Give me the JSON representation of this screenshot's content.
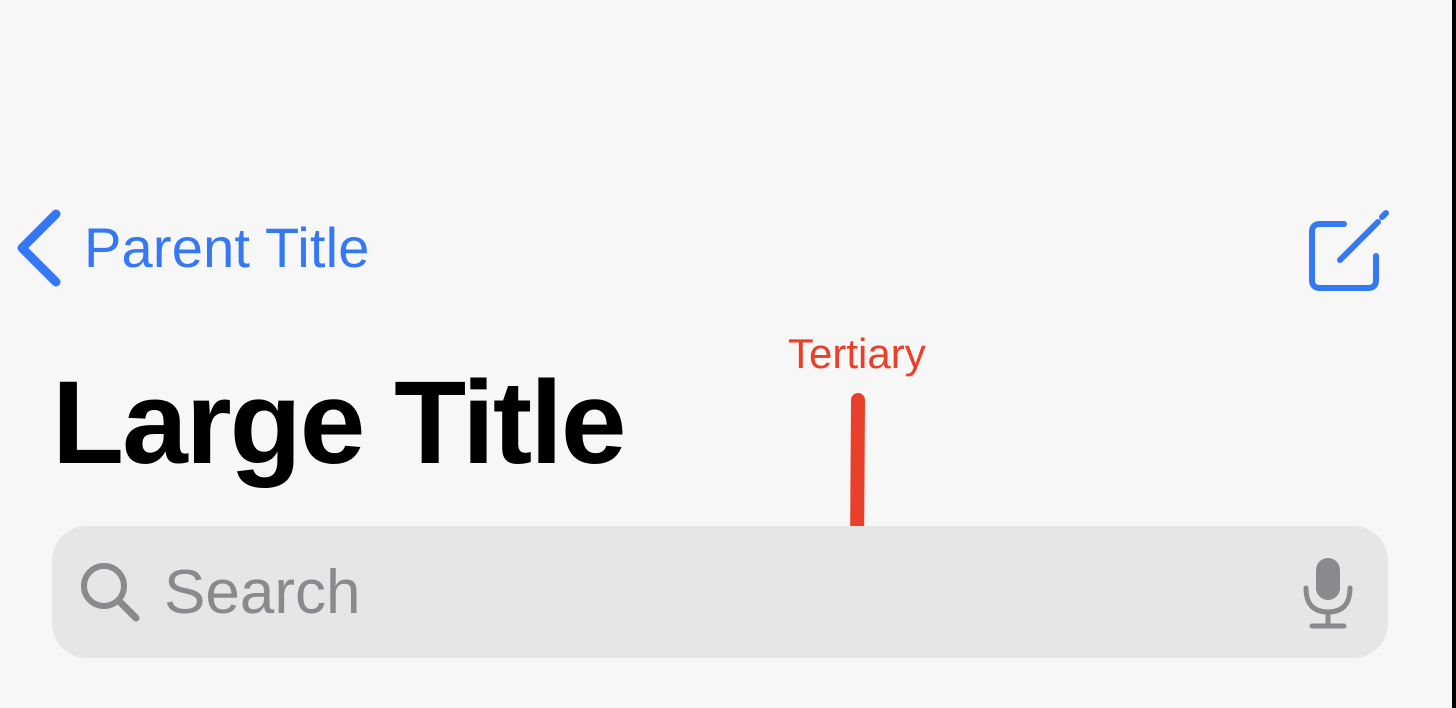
{
  "nav": {
    "back_label": "Parent Title",
    "back_icon": "chevron-left-icon",
    "compose_icon": "compose-icon"
  },
  "title": {
    "text": "Large Title"
  },
  "search": {
    "placeholder": "Search",
    "search_icon": "magnifying-glass-icon",
    "mic_icon": "microphone-icon"
  },
  "annotation": {
    "label": "Tertiary",
    "arrow_icon": "arrow-down-icon"
  },
  "colors": {
    "background": "#f7f7f7",
    "accent": "#3478f6",
    "title": "#000000",
    "search_fill": "#e6e6e6",
    "placeholder": "#8a8a8e",
    "annotation": "#e8402a"
  }
}
